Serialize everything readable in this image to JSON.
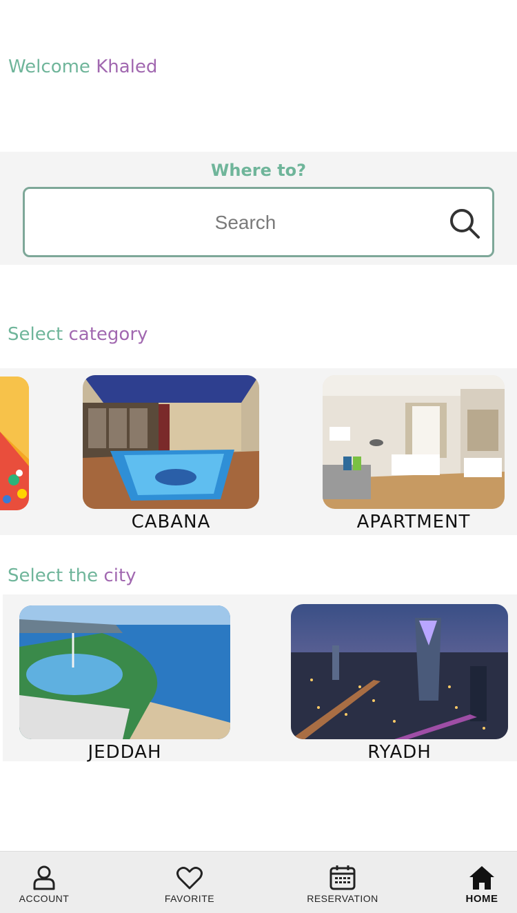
{
  "header": {
    "welcome_prefix": "Welcome",
    "user_name": "Khaled"
  },
  "search": {
    "heading": "Where to?",
    "placeholder": "Search",
    "icon": "search-icon"
  },
  "category": {
    "title_part1": "Select",
    "title_part2": "category",
    "items": [
      {
        "label": "",
        "image": "colorful-tent-image"
      },
      {
        "label": "CABANA",
        "image": "indoor-pool-image"
      },
      {
        "label": "APARTMENT",
        "image": "bedroom-image"
      }
    ]
  },
  "city": {
    "title_part1": "Select the",
    "title_part2": "city",
    "items": [
      {
        "label": "JEDDAH",
        "image": "jeddah-corniche-image"
      },
      {
        "label": "RYADH",
        "image": "riyadh-skyline-image"
      }
    ]
  },
  "nav": {
    "items": [
      {
        "label": "ACCOUNT",
        "icon": "user-icon"
      },
      {
        "label": "FAVORITE",
        "icon": "heart-icon"
      },
      {
        "label": "RESERVATION",
        "icon": "calendar-icon"
      },
      {
        "label": "HOME",
        "icon": "home-icon",
        "active": true
      }
    ]
  },
  "colors": {
    "accent_green": "#6fb59a",
    "accent_purple": "#a168b0",
    "search_border": "#7da798"
  }
}
